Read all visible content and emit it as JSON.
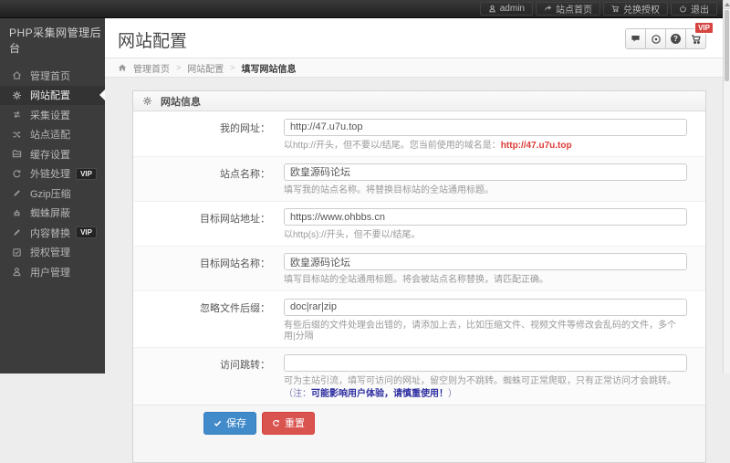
{
  "topbar": {
    "logo": "PHP采集网管理后台",
    "items": [
      {
        "label": "admin",
        "icon": "user-icon"
      },
      {
        "label": "站点首页",
        "icon": "share-icon"
      },
      {
        "label": "兑换授权",
        "icon": "cart-icon"
      },
      {
        "label": "退出",
        "icon": "power-icon"
      }
    ]
  },
  "sidebar": {
    "items": [
      {
        "label": "管理首页",
        "icon": "home-icon",
        "active": false
      },
      {
        "label": "网站配置",
        "icon": "gear-icon",
        "active": true
      },
      {
        "label": "采集设置",
        "icon": "collect-icon",
        "active": false
      },
      {
        "label": "站点适配",
        "icon": "shuffle-icon",
        "active": false
      },
      {
        "label": "缓存设置",
        "icon": "folder-icon",
        "active": false
      },
      {
        "label": "外链处理",
        "icon": "refresh-icon",
        "active": false,
        "badge": "VIP"
      },
      {
        "label": "Gzip压缩",
        "icon": "pencil-icon",
        "active": false
      },
      {
        "label": "蜘蛛屏蔽",
        "icon": "spider-icon",
        "active": false
      },
      {
        "label": "内容替换",
        "icon": "pencil-icon",
        "active": false,
        "badge": "VIP"
      },
      {
        "label": "授权管理",
        "icon": "check-square-icon",
        "active": false
      },
      {
        "label": "用户管理",
        "icon": "user-icon",
        "active": false
      }
    ]
  },
  "header": {
    "title": "网站配置",
    "toolbar_icons": [
      "comment-icon",
      "record-circle-icon",
      "help-icon",
      "cart-icon"
    ],
    "vip_badge": "VIP"
  },
  "breadcrumb": {
    "separator": ">",
    "items": [
      "管理首页",
      "网站配置",
      "填写网站信息"
    ]
  },
  "panel": {
    "title": "网站信息",
    "fields": [
      {
        "label": "我的网址：",
        "value": "http://47.u7u.top",
        "help_prefix": "以http://开头，但不要以/结尾。您当前使用的域名是：",
        "help_link": "http://47.u7u.top"
      },
      {
        "label": "站点名称：",
        "value": "欧皇源码论坛",
        "help": "填写我的站点名称。将替换目标站的全站通用标题。"
      },
      {
        "label": "目标网站地址：",
        "value": "https://www.ohbbs.cn",
        "help": "以http(s)://开头，但不要以/结尾。"
      },
      {
        "label": "目标网站名称：",
        "value": "欧皇源码论坛",
        "help": "填写目标站的全站通用标题。将会被站点名称替换，请匹配正确。"
      },
      {
        "label": "忽略文件后缀：",
        "value": "doc|rar|zip",
        "help": "有些后缀的文件处理会出错的，请添加上去，比如压缩文件、视频文件等修改会乱码的文件，多个用|分隔"
      },
      {
        "label": "访问跳转：",
        "value": "",
        "help": "可为主站引流，填写可访问的网址，留空则为不跳转。蜘蛛可正常爬取，只有正常访问才会跳转。",
        "note_prefix": "（注：",
        "note_bold": "可能影响用户体验，请慎重使用！",
        "note_suffix": "）"
      }
    ],
    "save_label": "保存",
    "reset_label": "重置"
  },
  "colors": {
    "topbar_bg": "#2a2a2a",
    "sidebar_bg": "#3c3c3c",
    "save_button": "#428bca",
    "reset_button": "#d9534f",
    "vip_tag": "#d64541",
    "red_link": "#dd3b36",
    "note_blue": "#2d2da0"
  }
}
